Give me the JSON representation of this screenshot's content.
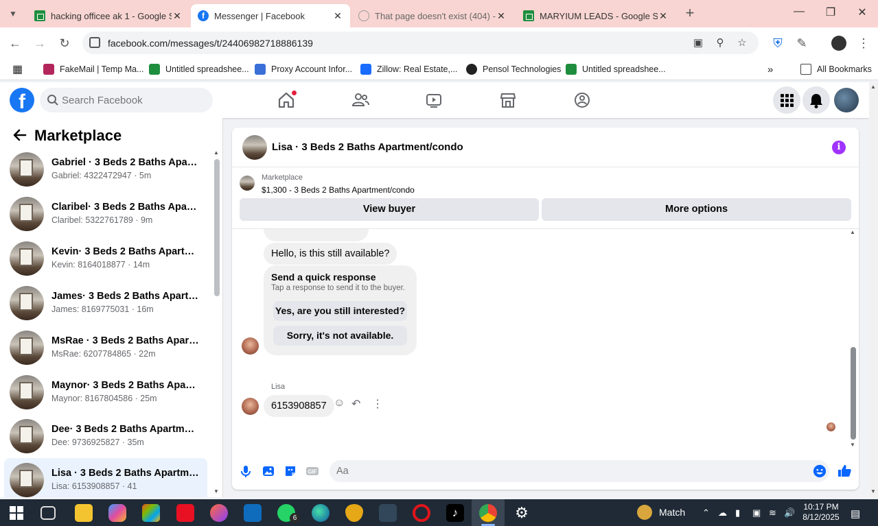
{
  "browser": {
    "tabs": [
      {
        "title": "hacking officee ak 1 - Google Sh",
        "icon": "sheets-icon",
        "active": false
      },
      {
        "title": "Messenger | Facebook",
        "icon": "facebook-icon",
        "active": true
      },
      {
        "title": "That page doesn't exist (404) - I",
        "icon": "error-icon",
        "active": false
      },
      {
        "title": "MARYIUM LEADS - Google Shee",
        "icon": "sheets-icon",
        "active": false
      }
    ],
    "url": "facebook.com/messages/t/24406982718886139",
    "bookmarks": [
      {
        "label": "FakeMail | Temp Ma...",
        "color": "#b3265c"
      },
      {
        "label": "Untitled spreadshee...",
        "color": "#1e8e3e"
      },
      {
        "label": "Proxy Account Infor...",
        "color": "#3a6fd8"
      },
      {
        "label": "Zillow: Real Estate,...",
        "color": "#1a6cff"
      },
      {
        "label": "Pensol Technologies",
        "color": "#222222"
      },
      {
        "label": "Untitled spreadshee...",
        "color": "#1e8e3e"
      }
    ],
    "all_bookmarks": "All Bookmarks"
  },
  "facebook": {
    "search_placeholder": "Search Facebook",
    "brand_color": "#1877f2"
  },
  "sidebar": {
    "title": "Marketplace",
    "conversations": [
      {
        "name": "Gabriel · 3 Beds 2 Baths Apartm...",
        "sub": "Gabriel: 4322472947 · 5m"
      },
      {
        "name": "Claribel· 3 Beds 2 Baths Apartm...",
        "sub": "Claribel: 5322761789 · 9m"
      },
      {
        "name": "Kevin· 3 Beds 2 Baths Apartmen...",
        "sub": "Kevin: 8164018877 · 14m"
      },
      {
        "name": "James· 3 Beds 2 Baths Apartme...",
        "sub": "James: 8169775031 · 16m"
      },
      {
        "name": "MsRae · 3 Beds 2 Baths Apartm...",
        "sub": "MsRae: 6207784865 · 22m"
      },
      {
        "name": "Maynor· 3 Beds 2 Baths Apartm...",
        "sub": "Maynor: 8167804586 · 25m"
      },
      {
        "name": "Dee· 3 Beds 2 Baths Apartment/...",
        "sub": "Dee: 9736925827 · 35m"
      },
      {
        "name": "Lisa · 3 Beds 2 Baths Apartment...",
        "sub": "Lisa: 6153908857 · 41",
        "selected": true
      }
    ]
  },
  "chat": {
    "title": "Lisa · 3 Beds 2 Baths Apartment/condo",
    "marketplace_label": "Marketplace",
    "listing": "$1,300 - 3 Beds 2 Baths Apartment/condo",
    "view_buyer": "View buyer",
    "more_options": "More options",
    "messages": {
      "question": "Hello, is this still available?",
      "quick_title": "Send a quick response",
      "quick_sub": "Tap a response to send it to the buyer.",
      "quick_1": "Yes, are you still interested?",
      "quick_2": "Sorry, it's not available.",
      "sender": "Lisa",
      "phone": "6153908857"
    },
    "composer_placeholder": "Aa"
  },
  "taskbar": {
    "weather": "Match",
    "time": "10:17 PM",
    "date": "8/12/2025",
    "whatsapp_badge": "6"
  }
}
